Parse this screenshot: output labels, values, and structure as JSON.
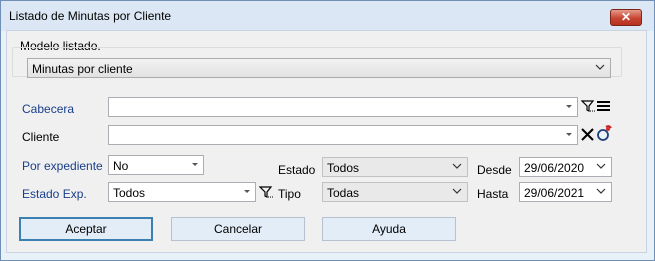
{
  "window": {
    "title": "Listado de Minutas por Cliente",
    "close_label": "✕"
  },
  "modelo": {
    "label": "Modelo listado.",
    "value": "Minutas por cliente"
  },
  "form": {
    "cabecera_label": "Cabecera",
    "cabecera_value": "",
    "cliente_label": "Cliente",
    "cliente_value": "",
    "por_expediente_label": "Por expediente",
    "por_expediente_value": "No",
    "estado_exp_label": "Estado Exp.",
    "estado_exp_value": "Todos",
    "estado_label": "Estado",
    "estado_value": "Todos",
    "tipo_label": "Tipo",
    "tipo_value": "Todas",
    "desde_label": "Desde",
    "desde_value": "29/06/2020",
    "hasta_label": "Hasta",
    "hasta_value": "29/06/2021"
  },
  "buttons": {
    "accept": "Aceptar",
    "cancel": "Cancelar",
    "help": "Ayuda"
  },
  "colors": {
    "accent": "#3c7fb1",
    "label_blue": "#1a3e8c",
    "close_red": "#c74533"
  },
  "icons": [
    "close-icon",
    "chevron-down-icon",
    "filter-icon",
    "list-icon",
    "clear-x-icon",
    "client-search-icon"
  ]
}
